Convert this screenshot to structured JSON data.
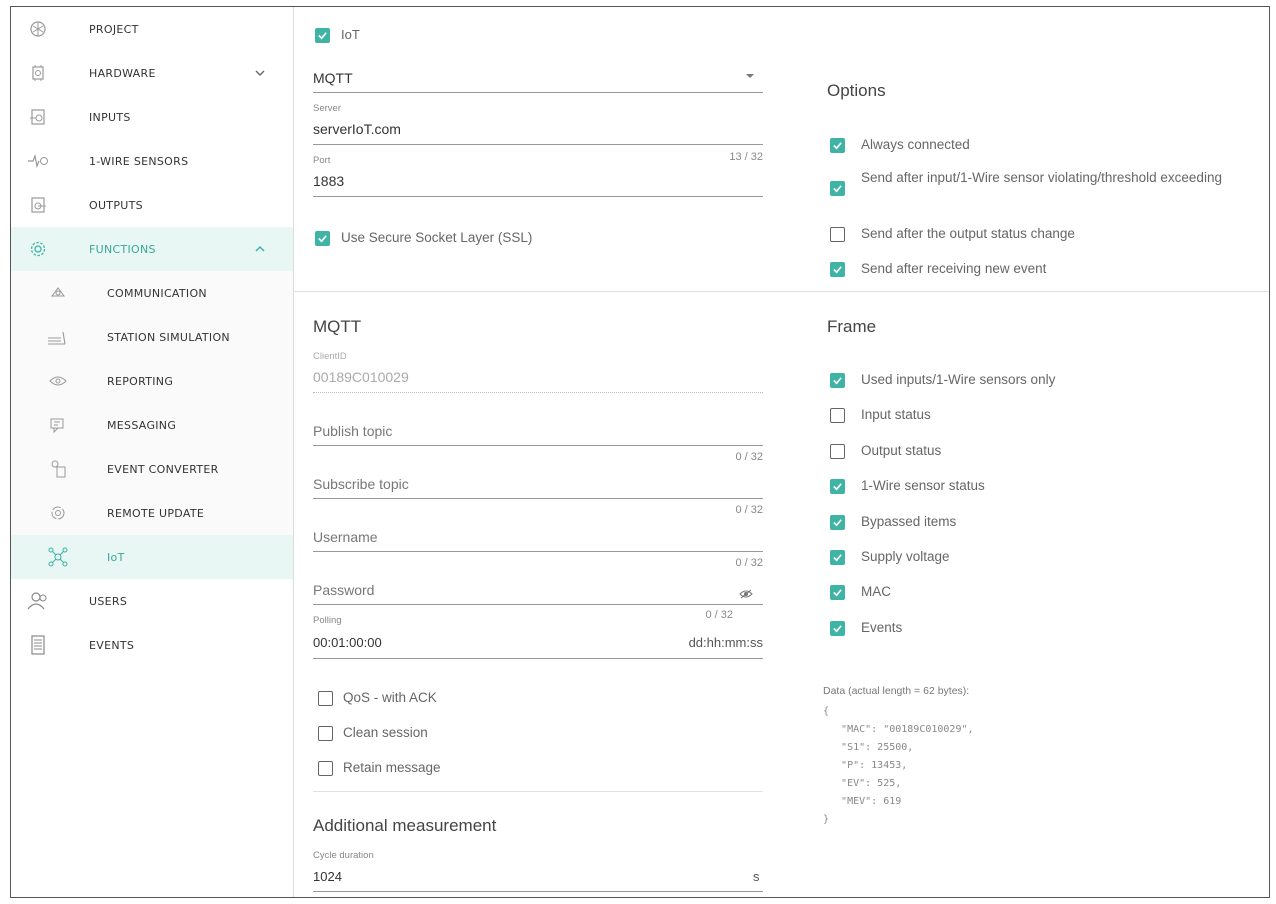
{
  "sidebar": {
    "items": [
      {
        "label": "PROJECT",
        "icon": "project-icon"
      },
      {
        "label": "HARDWARE",
        "icon": "hardware-icon"
      },
      {
        "label": "INPUTS",
        "icon": "inputs-icon"
      },
      {
        "label": "1-WIRE SENSORS",
        "icon": "sensor-icon"
      },
      {
        "label": "OUTPUTS",
        "icon": "outputs-icon"
      },
      {
        "label": "FUNCTIONS",
        "icon": "gear-icon"
      },
      {
        "label": "COMMUNICATION",
        "icon": "communication-icon"
      },
      {
        "label": "STATION SIMULATION",
        "icon": "station-icon"
      },
      {
        "label": "REPORTING",
        "icon": "eye-icon"
      },
      {
        "label": "MESSAGING",
        "icon": "messaging-icon"
      },
      {
        "label": "EVENT CONVERTER",
        "icon": "converter-icon"
      },
      {
        "label": "REMOTE UPDATE",
        "icon": "update-icon"
      },
      {
        "label": "IoT",
        "icon": "iot-icon"
      },
      {
        "label": "USERS",
        "icon": "users-icon"
      },
      {
        "label": "EVENTS",
        "icon": "events-icon"
      }
    ]
  },
  "iot": {
    "enabled_label": "IoT",
    "enabled": true,
    "protocol": "MQTT",
    "server_label": "Server",
    "server_value": "serverIoT.com",
    "server_counter": "13 / 32",
    "port_label": "Port",
    "port_value": "1883",
    "ssl_label": "Use Secure Socket Layer (SSL)",
    "ssl_checked": true
  },
  "mqtt": {
    "title": "MQTT",
    "client_id_label": "ClientID",
    "client_id_value": "00189C010029",
    "publish_placeholder": "Publish topic",
    "publish_counter": "0 / 32",
    "subscribe_placeholder": "Subscribe topic",
    "subscribe_counter": "0 / 32",
    "username_placeholder": "Username",
    "username_counter": "0 / 32",
    "password_placeholder": "Password",
    "password_counter": "0 / 32",
    "polling_label": "Polling",
    "polling_value": "00:01:00:00",
    "polling_unit": "dd:hh:mm:ss",
    "qos_label": "QoS - with ACK",
    "clean_label": "Clean session",
    "retain_label": "Retain message"
  },
  "additional": {
    "title": "Additional measurement",
    "cycle_label": "Cycle duration",
    "cycle_value": "1024",
    "cycle_unit": "s"
  },
  "options": {
    "title": "Options",
    "items": [
      {
        "label": "Always connected",
        "checked": true
      },
      {
        "label": "Send after input/1-Wire sensor violating/threshold exceeding",
        "checked": true
      },
      {
        "label": "Send after the output status change",
        "checked": false
      },
      {
        "label": "Send after receiving new event",
        "checked": true
      }
    ]
  },
  "frame": {
    "title": "Frame",
    "items": [
      {
        "label": "Used inputs/1-Wire sensors only",
        "checked": true
      },
      {
        "label": "Input status",
        "checked": false
      },
      {
        "label": "Output status",
        "checked": false
      },
      {
        "label": "1-Wire sensor status",
        "checked": true
      },
      {
        "label": "Bypassed items",
        "checked": true
      },
      {
        "label": "Supply voltage",
        "checked": true
      },
      {
        "label": "MAC",
        "checked": true
      },
      {
        "label": "Events",
        "checked": true
      }
    ],
    "data_caption": "Data (actual length = 62 bytes):",
    "data_json": "{\n   \"MAC\": \"00189C010029\",\n   \"S1\": 25500,\n   \"P\": 13453,\n   \"EV\": 525,\n   \"MEV\": 619\n}"
  },
  "colors": {
    "accent": "#3fb4a4",
    "active_bg": "#e8f6f4"
  }
}
